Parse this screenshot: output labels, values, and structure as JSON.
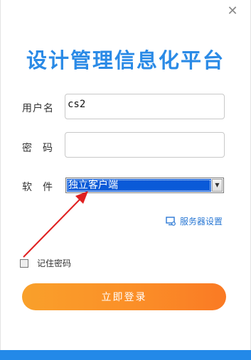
{
  "window": {
    "title": "设计管理信息化平台",
    "close_icon": "close-icon"
  },
  "form": {
    "username_label": "用户名",
    "username_value": "cs2",
    "password_label_1": "密",
    "password_label_2": "码",
    "password_value": "",
    "software_label_1": "软",
    "software_label_2": "件",
    "software_selected": "独立客户端"
  },
  "links": {
    "server_settings": "服务器设置",
    "server_icon": "monitor-settings-icon"
  },
  "remember": {
    "label": "记住密码",
    "checked": false
  },
  "login_button": "立即登录",
  "colors": {
    "title": "#2a8ae6",
    "accent": "#2389e8",
    "button_start": "#f9a02a",
    "button_end": "#fa7a24",
    "annotation_arrow": "#e02020"
  }
}
